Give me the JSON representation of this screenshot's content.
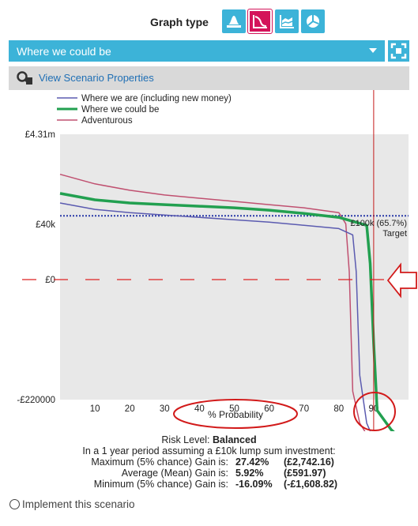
{
  "graph_type": {
    "label": "Graph type",
    "buttons": [
      {
        "icon": "distribution-icon",
        "selected": false,
        "color": "#3cb3d8"
      },
      {
        "icon": "probability-curve-icon",
        "selected": true,
        "color": "#d4145a"
      },
      {
        "icon": "area-chart-icon",
        "selected": false,
        "color": "#3cb3d8"
      },
      {
        "icon": "pie-chart-icon",
        "selected": false,
        "color": "#3cb3d8"
      }
    ]
  },
  "scenario_dropdown": {
    "value": "Where we could be"
  },
  "scenario_properties": {
    "label": "View Scenario Properties"
  },
  "chart_data": {
    "type": "line",
    "xlabel": "% Probability",
    "x_ticks": [
      "10",
      "20",
      "30",
      "40",
      "50",
      "60",
      "70",
      "80",
      "90"
    ],
    "xlim": [
      0,
      100
    ],
    "y_tick_labels": [
      "£4.31m",
      "£40k",
      "£0",
      "-£220000"
    ],
    "legend": [
      "Where we are (including new money)",
      "Where we could be",
      "Adventurous"
    ],
    "series": [
      {
        "name": "Where we are (including new money)",
        "color": "#5b5bb0",
        "x": [
          0,
          10,
          20,
          30,
          40,
          50,
          60,
          70,
          80,
          84,
          85,
          86,
          88,
          90,
          95,
          100
        ],
        "y": [
          48,
          44,
          42,
          40.5,
          39,
          37.5,
          36,
          34,
          32,
          28,
          5,
          -60,
          -90,
          -100,
          -108,
          -116
        ]
      },
      {
        "name": "Where we could be",
        "color": "#22a050",
        "x": [
          0,
          10,
          20,
          30,
          40,
          50,
          60,
          70,
          80,
          88,
          89,
          90,
          91,
          95,
          100
        ],
        "y": [
          54,
          50,
          48,
          47,
          46,
          45,
          43.5,
          41.5,
          39,
          34,
          10,
          -40,
          -82,
          -94,
          -104
        ]
      },
      {
        "name": "Adventurous",
        "color": "#c05070",
        "x": [
          0,
          10,
          20,
          30,
          40,
          50,
          60,
          70,
          80,
          82,
          83,
          84,
          86,
          88,
          92,
          100
        ],
        "y": [
          66,
          60,
          56,
          53,
          51,
          49,
          47,
          45,
          42,
          35,
          5,
          -70,
          -90,
          -97,
          -102,
          -112
        ]
      }
    ],
    "target": {
      "value": 40,
      "label": "£100k (65.7%)",
      "sublabel": "Target"
    },
    "marker_x": 90,
    "annotations": [
      "% Probability circled",
      "90 circled",
      "£0 line marked with arrow"
    ]
  },
  "summary": {
    "risk_label": "Risk Level:",
    "risk_value": "Balanced",
    "period_text": "In a 1 year period assuming a £10k lump sum investment:",
    "rows": [
      {
        "label": "Maximum (5% chance) Gain is:",
        "pct": "27.42%",
        "amount": "(£2,742.16)"
      },
      {
        "label": "Average (Mean) Gain is:",
        "pct": "5.92%",
        "amount": "(£591.97)"
      },
      {
        "label": "Minimum (5% chance) Gain is:",
        "pct": "-16.09%",
        "amount": "(-£1,608.82)"
      }
    ]
  },
  "implement": {
    "label": "Implement this scenario"
  }
}
